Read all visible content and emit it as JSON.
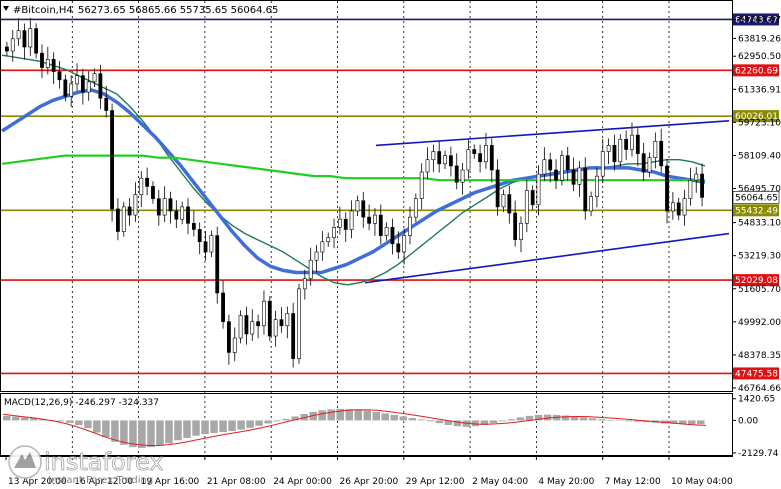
{
  "header": {
    "symbol_text": "#Bitcoin,H4",
    "ohlc_text": "56273.65 56865.66 55735.65 56064.65"
  },
  "colors": {
    "candle": "#000000",
    "red_level": "#e01010",
    "olive_level": "#8a8a00",
    "navy_level": "#1a1a6e",
    "ma_fast": "#1f7a5a",
    "ma_slow": "#3f6ed8",
    "ma_long": "#22cc22",
    "channel": "#1515c0",
    "macd_hist": "#a8a8a8",
    "macd_signal": "#e02020",
    "grid": "#000000"
  },
  "chart_data": {
    "type": "candlestick",
    "timeframe": "H4",
    "ylim": [
      46764.66,
      65400
    ],
    "y_ticks": [
      "64743.67",
      "63819.26",
      "62950.50",
      "61336.91",
      "59723.10",
      "58109.40",
      "56495.70",
      "54833.10",
      "53219.30",
      "51605.70",
      "49992.00",
      "48378.35",
      "46764.66"
    ],
    "x_ticks": [
      "13 Apr 20:00",
      "16 Apr 12:00",
      "19 Apr 16:00",
      "21 Apr 08:00",
      "24 Apr 00:00",
      "26 Apr 20:00",
      "29 Apr 12:00",
      "2 May 04:00",
      "4 May 20:00",
      "7 May 12:00",
      "10 May 04:00"
    ],
    "levels": [
      {
        "value": 64743.67,
        "label": "64743.67",
        "kind": "navy"
      },
      {
        "value": 62260.69,
        "label": "62260.69",
        "kind": "red"
      },
      {
        "value": 60026.01,
        "label": "60026.01",
        "kind": "olive"
      },
      {
        "value": 55432.49,
        "label": "55432.49",
        "kind": "olive"
      },
      {
        "value": 52029.08,
        "label": "52029.08",
        "kind": "red"
      },
      {
        "value": 47475.58,
        "label": "47475.58",
        "kind": "red"
      }
    ],
    "current_price": {
      "value": 56064.65,
      "label": "56064.65"
    },
    "channel": {
      "upper": [
        [
          35,
          58600
        ],
        [
          117,
          59800
        ]
      ],
      "lower": [
        [
          60,
          51900
        ],
        [
          117,
          54300
        ]
      ]
    },
    "candles_note": "approximate close path, 120 H4 bars",
    "closes": [
      63200,
      63800,
      64200,
      63400,
      64300,
      63100,
      62400,
      62800,
      62200,
      61800,
      61000,
      61600,
      62000,
      61200,
      61700,
      62100,
      60900,
      60300,
      55500,
      54400,
      55600,
      55200,
      56200,
      57000,
      56600,
      56000,
      55200,
      56000,
      55400,
      55000,
      55600,
      54800,
      54500,
      53900,
      53400,
      54200,
      51400,
      50000,
      48500,
      49200,
      50300,
      49400,
      50000,
      49800,
      51000,
      49300,
      50100,
      49800,
      50400,
      48200,
      51600,
      52100,
      53000,
      53400,
      53900,
      54100,
      54600,
      55000,
      54500,
      55400,
      55900,
      55100,
      54800,
      55200,
      54200,
      54600,
      53800,
      53400,
      54200,
      55100,
      56000,
      57300,
      57900,
      58300,
      57700,
      58100,
      57600,
      56800,
      57400,
      58400,
      58200,
      57800,
      58600,
      57400,
      55600,
      56200,
      55300,
      54000,
      54800,
      56400,
      55700,
      57200,
      57900,
      57400,
      56900,
      58100,
      57400,
      56700,
      57500,
      55400,
      56100,
      57100,
      58300,
      58600,
      57800,
      58900,
      58400,
      59100,
      58200,
      57300,
      58000,
      58800,
      57600,
      55400,
      55800,
      55200,
      56000,
      56900,
      57200,
      56064
    ],
    "series": [
      {
        "name": "ma_fast",
        "values": [
          63000,
          62900,
          62800,
          62700,
          62500,
          62300,
          62000,
          61700,
          61400,
          61100,
          60500,
          59800,
          59000,
          58100,
          57300,
          56500,
          55800,
          55200,
          54700,
          54300,
          54000,
          53700,
          53400,
          53000,
          52600,
          52200,
          51900,
          51800,
          51900,
          52100,
          52400,
          52800,
          53300,
          53800,
          54300,
          54800,
          55300,
          55700,
          56100,
          56500,
          56800,
          57000,
          57100,
          57200,
          57300,
          57400,
          57500,
          57500,
          57600,
          57700,
          57700,
          57800,
          57900,
          57900,
          57800,
          57600
        ]
      },
      {
        "name": "ma_slow",
        "values": [
          59300,
          59700,
          60100,
          60500,
          60800,
          61000,
          61200,
          61300,
          61100,
          60700,
          60200,
          59600,
          59000,
          58300,
          57600,
          56800,
          56000,
          55200,
          54400,
          53700,
          53100,
          52700,
          52500,
          52400,
          52400,
          52400,
          52600,
          52800,
          53100,
          53400,
          53800,
          54200,
          54600,
          55000,
          55400,
          55700,
          56000,
          56300,
          56500,
          56700,
          56900,
          57000,
          57100,
          57200,
          57300,
          57400,
          57500,
          57500,
          57500,
          57500,
          57400,
          57300,
          57100,
          57000,
          56900,
          56800
        ]
      },
      {
        "name": "ma_long",
        "values": [
          57700,
          57800,
          57900,
          58000,
          58100,
          58100,
          58100,
          58100,
          58100,
          58100,
          58000,
          58000,
          57900,
          57800,
          57700,
          57600,
          57500,
          57400,
          57300,
          57200,
          57100,
          57100,
          57000,
          57000,
          57000,
          57000,
          57000,
          57000,
          56900,
          56900,
          56900,
          56900,
          56900,
          56900,
          56900,
          56900,
          56900,
          56900,
          56900,
          56900,
          56900,
          56900,
          56900,
          56900,
          56900,
          56900
        ]
      }
    ],
    "macd": {
      "label": "MACD(12,26,9) -246.297 -324.337",
      "ylim": [
        -2200,
        1600
      ],
      "y_ticks": [
        "1420.65",
        "0.00",
        "-2129.74"
      ],
      "hist": [
        300,
        250,
        200,
        150,
        80,
        20,
        -60,
        -160,
        -300,
        -500,
        -800,
        -1100,
        -1400,
        -1600,
        -1750,
        -1800,
        -1750,
        -1650,
        -1500,
        -1300,
        -1150,
        -1000,
        -900,
        -820,
        -760,
        -700,
        -600,
        -480,
        -350,
        -200,
        -60,
        100,
        260,
        420,
        560,
        660,
        720,
        760,
        740,
        700,
        640,
        560,
        460,
        360,
        260,
        160,
        60,
        -60,
        -180,
        -300,
        -380,
        -420,
        -380,
        -300,
        -180,
        -60,
        80,
        200,
        300,
        360,
        380,
        360,
        320,
        260,
        200,
        140,
        80,
        20,
        -20,
        -60,
        -80,
        -120,
        -160,
        -200,
        -220,
        -240,
        -250,
        -246
      ],
      "signal": [
        400,
        330,
        260,
        190,
        110,
        20,
        -90,
        -230,
        -400,
        -600,
        -820,
        -1040,
        -1240,
        -1400,
        -1520,
        -1600,
        -1640,
        -1640,
        -1600,
        -1520,
        -1420,
        -1300,
        -1180,
        -1060,
        -950,
        -850,
        -750,
        -640,
        -520,
        -390,
        -250,
        -100,
        40,
        180,
        320,
        440,
        540,
        620,
        680,
        700,
        690,
        660,
        600,
        520,
        440,
        350,
        260,
        160,
        60,
        -40,
        -130,
        -200,
        -240,
        -250,
        -230,
        -190,
        -130,
        -60,
        20,
        100,
        170,
        220,
        250,
        260,
        250,
        220,
        180,
        140,
        90,
        40,
        -10,
        -60,
        -110,
        -160,
        -210,
        -260,
        -300,
        -324
      ]
    }
  },
  "watermark": {
    "brand": "instaforex",
    "tagline": "Instant Forex Trading"
  }
}
